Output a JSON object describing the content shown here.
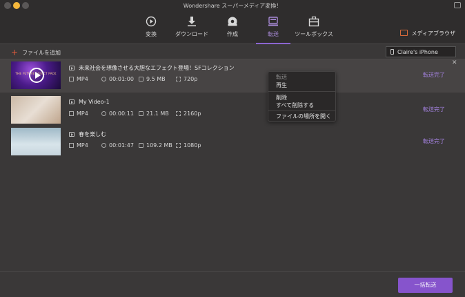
{
  "window": {
    "title": "Wondershare スーパーメディア変換！"
  },
  "toolbar": {
    "tabs": [
      {
        "label": "変換",
        "icon": "convert-icon"
      },
      {
        "label": "ダウンロード",
        "icon": "download-icon"
      },
      {
        "label": "作成",
        "icon": "burn-icon"
      },
      {
        "label": "転送",
        "icon": "transfer-icon",
        "active": true
      },
      {
        "label": "ツールボックス",
        "icon": "toolbox-icon"
      }
    ],
    "media_browser": "メディアブラウザ"
  },
  "actionbar": {
    "add_file": "ファイルを追加",
    "device": "Claire's iPhone"
  },
  "files": [
    {
      "name": "未来社会を想像させる大胆なエフェクト登場！SFコレクション",
      "format": "MP4",
      "duration": "00:01:00",
      "size": "9.5 MB",
      "resolution": "720p",
      "status": "転送完了",
      "thumb_caption": "THE FUTURE EFFECT PACK"
    },
    {
      "name": "My Video-1",
      "format": "MP4",
      "duration": "00:00:11",
      "size": "21.1 MB",
      "resolution": "2160p",
      "status": "転送完了"
    },
    {
      "name": "春を楽しむ",
      "format": "MP4",
      "duration": "00:01:47",
      "size": "109.2 MB",
      "resolution": "1080p",
      "status": "転送完了"
    }
  ],
  "context_menu": {
    "items": [
      {
        "label": "転送",
        "disabled": true
      },
      {
        "label": "再生"
      },
      {
        "label": "削除"
      },
      {
        "label": "すべて削除する"
      },
      {
        "label": "ファイルの場所を開く"
      }
    ]
  },
  "footer": {
    "batch_button": "一括転送"
  },
  "colors": {
    "accent": "#8654cc",
    "status": "#a482e0",
    "add_icon": "#e35a3a"
  }
}
